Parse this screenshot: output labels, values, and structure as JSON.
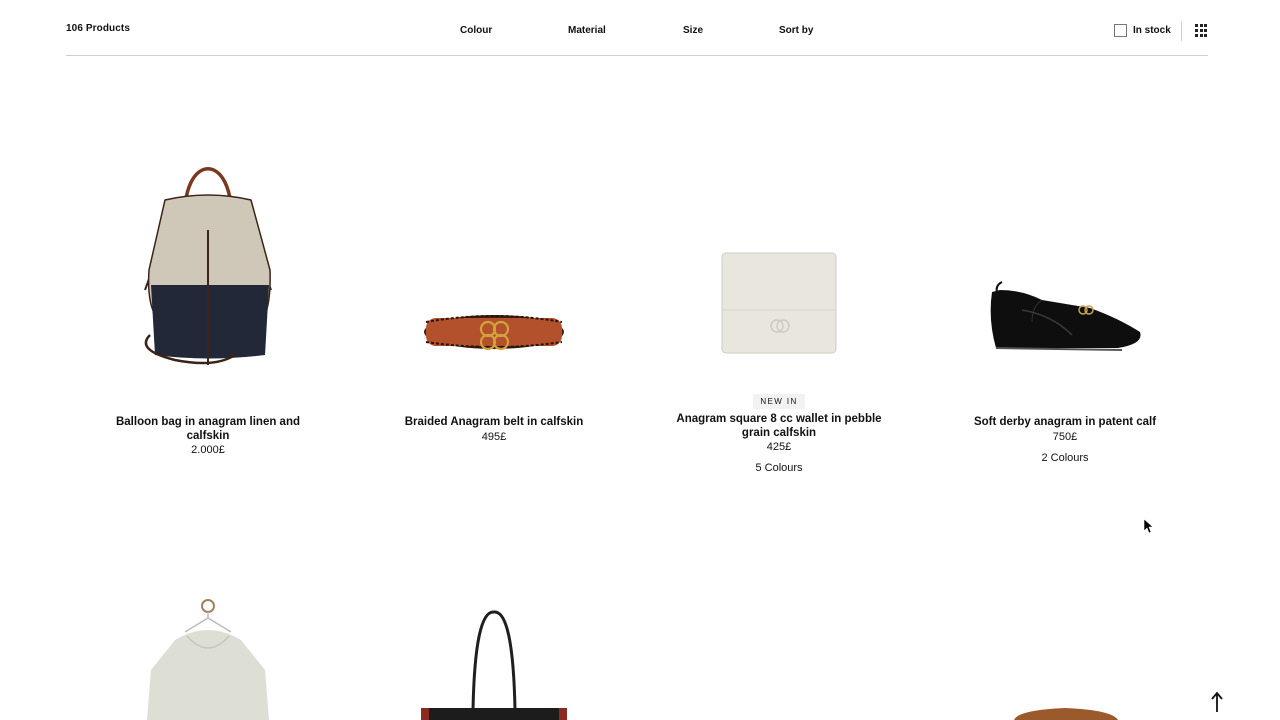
{
  "header": {
    "product_count": "106 Products",
    "filters": {
      "colour": "Colour",
      "material": "Material",
      "size": "Size",
      "sort": "Sort by"
    },
    "in_stock_label": "In stock",
    "in_stock_checked": false,
    "grid_icon": "grid-icon"
  },
  "products": [
    {
      "title": "Balloon bag in anagram linen and calfskin",
      "price": "2.000£",
      "badge": "",
      "colours": ""
    },
    {
      "title": "Braided Anagram belt in calfskin",
      "price": "495£",
      "badge": "",
      "colours": ""
    },
    {
      "title": "Anagram square 8 cc wallet in pebble grain calfskin",
      "price": "425£",
      "badge": "NEW IN",
      "colours": "5 Colours"
    },
    {
      "title": "Soft derby anagram in patent calf",
      "price": "750£",
      "badge": "",
      "colours": "2 Colours"
    }
  ],
  "row2_images": [
    "hoodie-on-hanger",
    "leather-tote",
    "",
    "tan-leather-bag"
  ],
  "back_to_top_icon": "arrow-up-icon",
  "colors": {
    "text": "#111111",
    "divider": "#cfcfcf",
    "badge_bg": "#f2f2f2"
  }
}
